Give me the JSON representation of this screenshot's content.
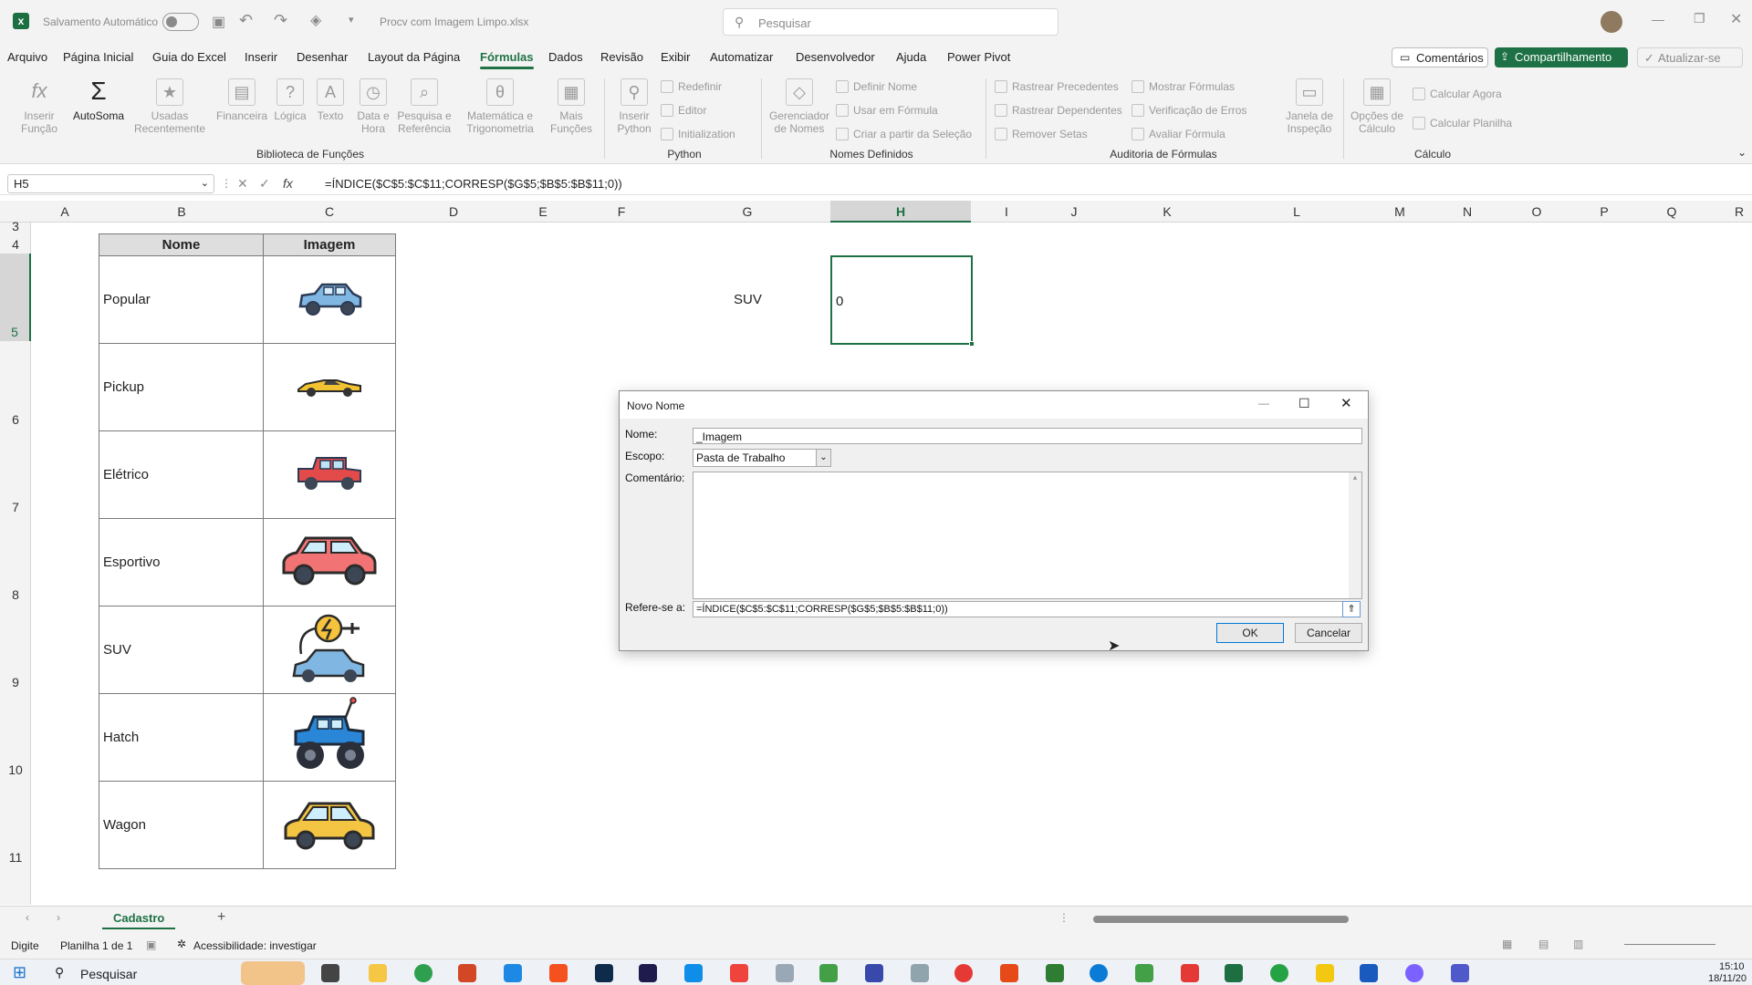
{
  "titlebar": {
    "autosave_label": "Salvamento Automático",
    "filename": "Procv com Imagem Limpo.xlsx",
    "search_placeholder": "Pesquisar"
  },
  "menu": {
    "items": [
      "Arquivo",
      "Página Inicial",
      "Guia do Excel",
      "Inserir",
      "Desenhar",
      "Layout da Página",
      "Fórmulas",
      "Dados",
      "Revisão",
      "Exibir",
      "Automatizar",
      "Desenvolvedor",
      "Ajuda",
      "Power Pivot"
    ],
    "active": "Fórmulas",
    "comments_label": "Comentários",
    "share_label": "Compartilhamento",
    "update_label": "Atualizar-se"
  },
  "ribbon": {
    "insert_function": "Inserir\nFunção",
    "autosum": "AutoSoma",
    "recently_used": "Usadas\nRecentemente",
    "financial": "Financeira",
    "logical": "Lógica",
    "text": "Texto",
    "date_time": "Data e\nHora",
    "lookup": "Pesquisa e\nReferência",
    "math": "Matemática e\nTrigonometria",
    "more": "Mais\nFunções",
    "group_library": "Biblioteca de Funções",
    "insert_python": "Inserir\nPython",
    "reset": "Redefinir",
    "editor": "Editor",
    "initialization": "Initialization",
    "group_python": "Python",
    "name_manager": "Gerenciador\nde Nomes",
    "define_name": "Definir Nome",
    "use_in_formula": "Usar em Fórmula",
    "create_from_selection": "Criar a partir da Seleção",
    "group_names": "Nomes Definidos",
    "trace_precedents": "Rastrear Precedentes",
    "trace_dependents": "Rastrear Dependentes",
    "remove_arrows": "Remover Setas",
    "show_formulas": "Mostrar Fórmulas",
    "error_checking": "Verificação de Erros",
    "evaluate_formula": "Avaliar Fórmula",
    "watch_window": "Janela de\nInspeção",
    "group_audit": "Auditoria de Fórmulas",
    "calc_options": "Opções de\nCálculo",
    "calc_now": "Calcular Agora",
    "calc_sheet": "Calcular Planilha",
    "group_calc": "Cálculo"
  },
  "formula_bar": {
    "name_box": "H5",
    "formula": "=ÍNDICE($C$5:$C$11;CORRESP($G$5;$B$5:$B$11;0))"
  },
  "columns": [
    "A",
    "B",
    "C",
    "D",
    "E",
    "F",
    "G",
    "H",
    "I",
    "J",
    "K",
    "L",
    "M",
    "N",
    "O",
    "P",
    "Q",
    "R"
  ],
  "rows": [
    "3",
    "4",
    "5",
    "6",
    "7",
    "8",
    "9",
    "10",
    "11"
  ],
  "table": {
    "header_name": "Nome",
    "header_image": "Imagem",
    "rows": [
      {
        "name": "Popular",
        "icon": "car-blue-icon"
      },
      {
        "name": "Pickup",
        "icon": "car-yellow-sport-icon"
      },
      {
        "name": "Elétrico",
        "icon": "jeep-red-icon"
      },
      {
        "name": "Esportivo",
        "icon": "car-red-icon"
      },
      {
        "name": "SUV",
        "icon": "electric-car-icon"
      },
      {
        "name": "Hatch",
        "icon": "monster-truck-icon"
      },
      {
        "name": "Wagon",
        "icon": "taxi-yellow-icon"
      }
    ]
  },
  "lookup": {
    "key": "SUV",
    "result": "0"
  },
  "dialog": {
    "title": "Novo Nome",
    "name_label": "Nome:",
    "name_value": "_Imagem",
    "scope_label": "Escopo:",
    "scope_value": "Pasta de Trabalho",
    "comment_label": "Comentário:",
    "refers_label": "Refere-se a:",
    "refers_value": "=ÍNDICE($C$5:$C$11;CORRESP($G$5;$B$5:$B$11;0))",
    "ok": "OK",
    "cancel": "Cancelar"
  },
  "sheet_tab": "Cadastro",
  "status": {
    "mode": "Digite",
    "sheet_info": "Planilha 1 de 1",
    "accessibility": "Acessibilidade: investigar"
  },
  "taskbar": {
    "search": "Pesquisar",
    "time": "15:10",
    "date": "18/11/20"
  },
  "colors": {
    "excel_green": "#217346",
    "selection_green": "#1e7145"
  }
}
